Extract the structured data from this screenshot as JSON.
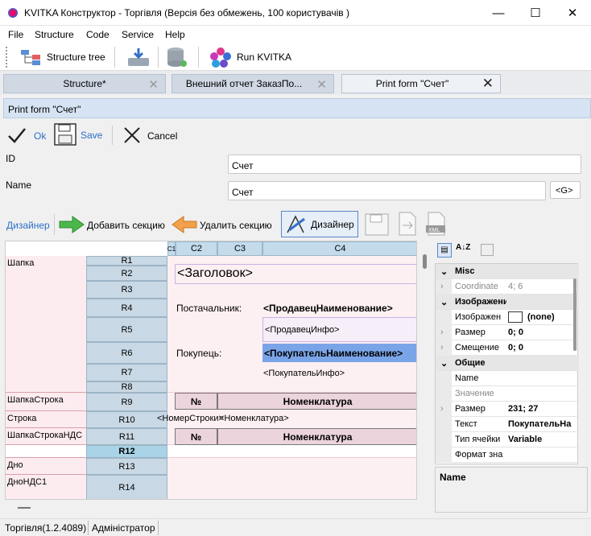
{
  "window": {
    "title": "KVITKA Конструктор - Торгівля (Версія без обмежень, 100 користувачів )",
    "minimize": "—",
    "maximize": "☐",
    "close": "✕"
  },
  "menu": [
    "File",
    "Structure",
    "Code",
    "Service",
    "Help"
  ],
  "toolbar": {
    "structure_tree": "Structure tree",
    "run": "Run KVITKA"
  },
  "tabs": [
    {
      "label": "Structure*",
      "close": "✕"
    },
    {
      "label": "Внешний отчет ЗаказПо...",
      "close": "✕"
    },
    {
      "label": "Print form \"Счет\"",
      "close": "✕"
    }
  ],
  "print_form_title": "Print form \"Счет\"",
  "actions": {
    "ok": "Ok",
    "save": "Save",
    "cancel": "Cancel"
  },
  "form": {
    "id_label": "ID",
    "id_value": "Счет",
    "name_label": "Name",
    "name_value": "Счет",
    "g_button": "<G>"
  },
  "designer": {
    "link": "Дизайнер",
    "add_section": "Добавить секцию",
    "remove_section": "Удалить секцию",
    "designer_button": "Дизайнер"
  },
  "grid": {
    "columns": [
      "C1",
      "C2",
      "C3",
      "C4"
    ],
    "rows": [
      "R1",
      "R2",
      "R3",
      "R4",
      "R5",
      "R6",
      "R7",
      "R8",
      "R9",
      "R10",
      "R11",
      "R12",
      "R13",
      "R14"
    ],
    "sections": [
      "Шапка",
      "ШапкаСтрока",
      "Строка",
      "ШапкаСтрокаНДС",
      "Дно",
      "ДноНДС1"
    ],
    "cells": {
      "header": "<Заголовок>",
      "supplier_label": "Постачальник:",
      "supplier_name": "<ПродавецНаименование>",
      "supplier_info": "<ПродавецИнфо>",
      "buyer_label": "Покупець:",
      "buyer_name": "<ПокупательНаименование>",
      "buyer_info": "<ПокупательИнфо>",
      "no1": "№",
      "nom1": "Номенклатура",
      "row_no": "<НомерСтроки>",
      "row_nom": "<Номенклатура>",
      "no2": "№",
      "nom2": "Номенклатура"
    }
  },
  "properties": {
    "categories": [
      {
        "name": "Misc",
        "items": [
          {
            "name": "Coordinate",
            "value": "4; 6"
          }
        ]
      },
      {
        "name": "Изображение",
        "items": [
          {
            "name": "Изображен",
            "value": "(none)"
          },
          {
            "name": "Размер",
            "value": "0; 0"
          },
          {
            "name": "Смещение",
            "value": "0; 0"
          }
        ]
      },
      {
        "name": "Общие",
        "items": [
          {
            "name": "Name",
            "value": ""
          },
          {
            "name": "Значение",
            "value": ""
          },
          {
            "name": "Размер",
            "value": "231; 27"
          },
          {
            "name": "Текст",
            "value": "ПокупательНа"
          },
          {
            "name": "Тип ячейки",
            "value": "Variable"
          },
          {
            "name": "Формат зна",
            "value": ""
          }
        ]
      }
    ],
    "description_title": "Name"
  },
  "status": {
    "left": "Торгівля(1.2.4089)",
    "user": "Адміністратор"
  },
  "colors": {
    "accent": "#4a6fd0",
    "selection": "#7aa4e8",
    "section_bg": "#fdecef"
  }
}
